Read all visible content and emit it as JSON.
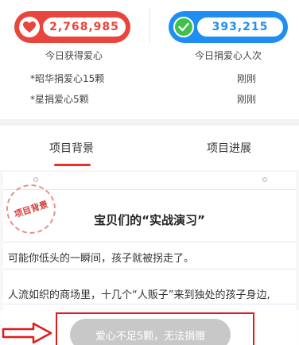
{
  "stats": {
    "hearts_received": "2,768,985",
    "donors_count": "393,215",
    "hearts_label": "今日获得爱心",
    "donors_label": "今日捐爱心人次",
    "colors": {
      "red": "#e8453c",
      "blue": "#1f8ef2",
      "green": "#3fc04a"
    }
  },
  "donations": [
    {
      "name": "*昭华捐爱心15颗",
      "time": "刚刚"
    },
    {
      "name": "*星捐爱心5颗",
      "time": "刚刚"
    }
  ],
  "tabs": [
    {
      "label": "项目背景",
      "active": true
    },
    {
      "label": "项目进展",
      "active": false
    }
  ],
  "article": {
    "stamp": "项目背景",
    "title": "宝贝们的“实战演习”",
    "paragraphs": [
      "可能你低头的一瞬间，孩子就被拐走了。",
      "人流如织的商场里，十几个“人贩子”来到独处的孩子身边,"
    ]
  },
  "action": {
    "donate_label": "爱心不足5颗，无法捐赠",
    "disabled": true
  }
}
